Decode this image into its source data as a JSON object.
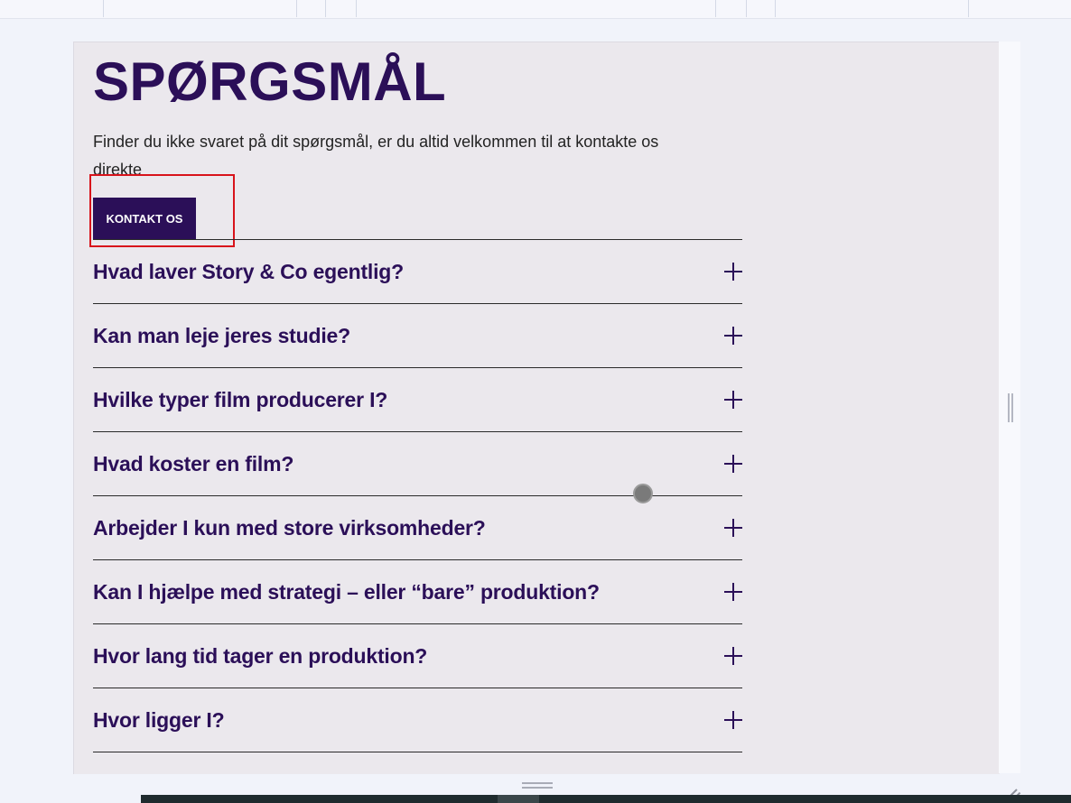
{
  "page": {
    "title": "SPØRGSMÅL",
    "intro": "Finder du ikke svaret på dit spørgsmål, er du altid velkommen til at kontakte os direkte",
    "cta_label": "KONTAKT OS"
  },
  "faq": [
    {
      "question": "Hvad laver Story & Co egentlig?"
    },
    {
      "question": "Kan man leje jeres studie?"
    },
    {
      "question": "Hvilke typer film producerer I?"
    },
    {
      "question": "Hvad koster en film?"
    },
    {
      "question": "Arbejder I kun med store virksomheder?"
    },
    {
      "question": "Kan I hjælpe med strategi – eller “bare” produktion?"
    },
    {
      "question": "Hvor lang tid tager en produktion?"
    },
    {
      "question": "Hvor ligger I?"
    }
  ],
  "colors": {
    "accent": "#2b0f58",
    "canvas": "#ebe8ed",
    "highlight": "#d8131b"
  },
  "icons": {
    "expand": "plus-icon"
  }
}
